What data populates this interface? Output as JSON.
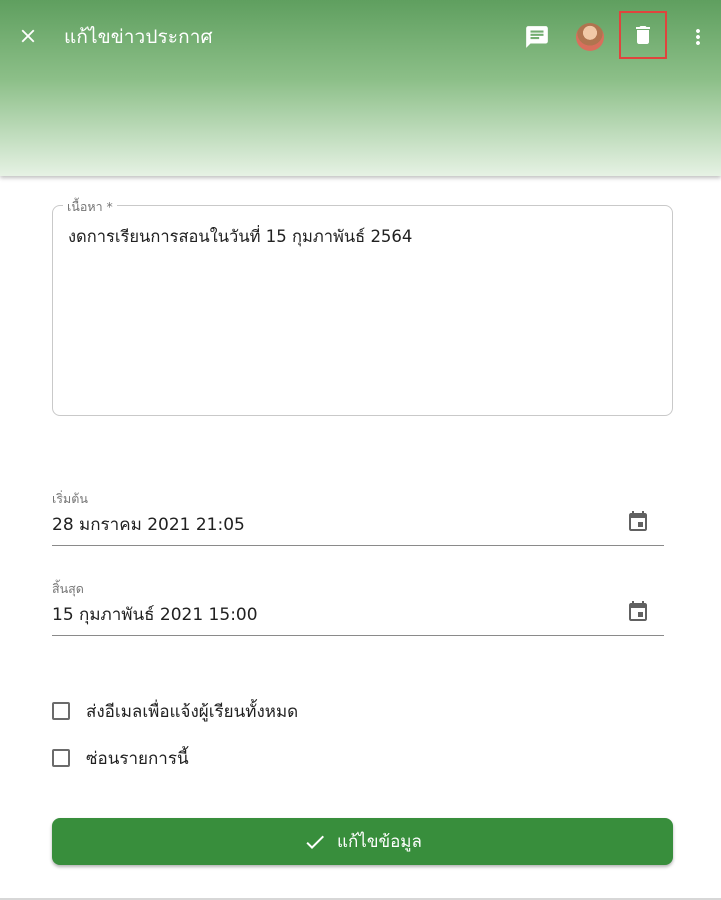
{
  "header": {
    "title": "แก้ไขข่าวประกาศ",
    "icons": {
      "close": "close-icon",
      "comment": "comment-icon",
      "avatar": "avatar",
      "delete": "trash-icon",
      "more": "more-vert-icon"
    },
    "colors": {
      "gradient_top": "#5f9f5f",
      "gradient_bottom": "#e6f2e4",
      "highlight": "#e0443d"
    }
  },
  "form": {
    "content": {
      "label": "เนื้อหา *",
      "value": "งดการเรียนการสอนในวันที่ 15 กุมภาพันธ์ 2564"
    },
    "start": {
      "label": "เริ่มต้น",
      "value": "28 มกราคม 2021 21:05",
      "icon": "calendar-icon"
    },
    "end": {
      "label": "สิ้นสุด",
      "value": "15 กุมภาพันธ์ 2021 15:00",
      "icon": "calendar-icon"
    },
    "checkboxes": [
      {
        "label": "ส่งอีเมลเพื่อแจ้งผู้เรียนทั้งหมด",
        "checked": false
      },
      {
        "label": "ซ่อนรายการนี้",
        "checked": false
      }
    ],
    "submit": {
      "label": "แก้ไขข้อมูล",
      "icon": "check-icon",
      "color": "#388e3c"
    }
  }
}
